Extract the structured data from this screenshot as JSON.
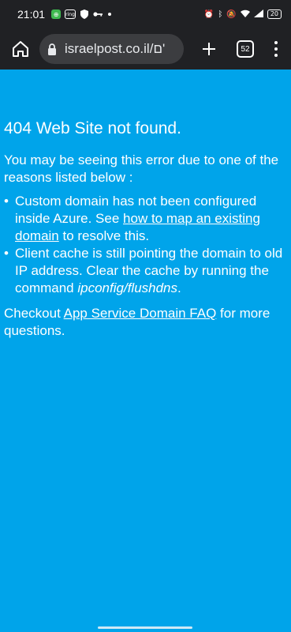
{
  "status_bar": {
    "time": "21:01",
    "notification_icons": [
      "app-icon",
      "ring-icon",
      "shield-icon",
      "key-icon"
    ],
    "battery": "20"
  },
  "browser": {
    "url_text": "israelpost.co.il/ם'",
    "tab_count": "52"
  },
  "page": {
    "title": "404 Web Site not found.",
    "intro": "You may be seeing this error due to one of the reasons listed below :",
    "reason1": {
      "prefix": "Custom domain has not been configured inside Azure. See ",
      "link": "how to map an existing domain",
      "suffix": " to resolve this."
    },
    "reason2": {
      "prefix": "Client cache is still pointing the domain to old IP address. Clear the cache by running the command ",
      "command": "ipconfig/flushdns",
      "suffix": "."
    },
    "checkout": {
      "prefix": "Checkout ",
      "link": "App Service Domain FAQ",
      "suffix": " for more questions."
    },
    "bg_color": "#00a4ea"
  }
}
